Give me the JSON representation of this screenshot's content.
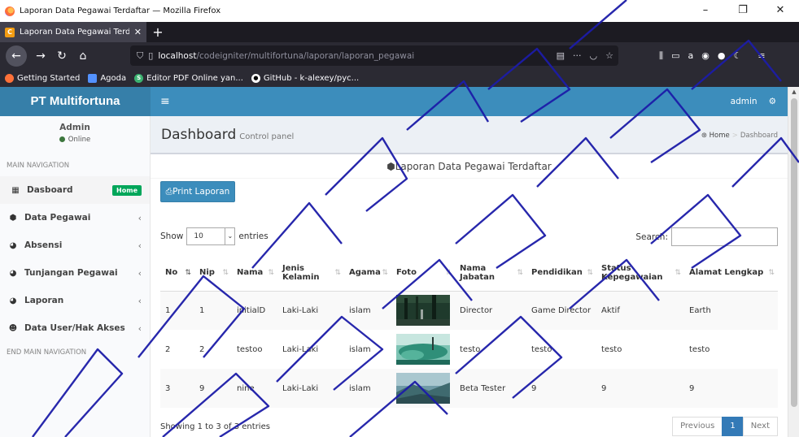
{
  "window": {
    "title": "Laporan Data Pegawai Terdaftar — Mozilla Firefox",
    "controls": {
      "minimize": "–",
      "maximize": "❐",
      "close": "✕"
    }
  },
  "tab": {
    "label": "Laporan Data Pegawai Terdaftar",
    "close": "✕",
    "new_tab": "+"
  },
  "nav": {
    "url_host": "localhost",
    "url_path": "/codeigniter/multifortuna/laporan/laporan_pegawai"
  },
  "bookmarks": [
    {
      "label": "Getting Started",
      "color": "#ff7139"
    },
    {
      "label": "Agoda",
      "color": "#5392ff"
    },
    {
      "label": "Editor PDF Online yan...",
      "color": "#3cb371"
    },
    {
      "label": "GitHub - k-alexey/pyc...",
      "color": "#ffffff"
    }
  ],
  "app": {
    "brand": "PT Multifortuna",
    "user_menu": "admin",
    "user_panel": {
      "name": "Admin",
      "status": "Online"
    },
    "nav_header": "MAIN NAVIGATION",
    "nav_footer": "END MAIN NAVIGATION",
    "menu": [
      {
        "label": "Dasboard",
        "icon": "grid-icon",
        "badge": "Home"
      },
      {
        "label": "Data Pegawai",
        "icon": "cubes-icon",
        "chev": "‹"
      },
      {
        "label": "Absensi",
        "icon": "pie-chart-icon",
        "chev": "‹"
      },
      {
        "label": "Tunjangan Pegawai",
        "icon": "pie-chart-icon",
        "chev": "‹"
      },
      {
        "label": "Laporan",
        "icon": "pie-chart-icon",
        "chev": "‹"
      },
      {
        "label": "Data User/Hak Akses",
        "icon": "users-icon",
        "chev": "‹"
      }
    ]
  },
  "page": {
    "title": "Dashboard",
    "subtitle": "Control panel",
    "breadcrumb": {
      "home": "Home",
      "current": "Dashboard"
    },
    "box_title": "Laporan Data Pegawai Terdaftar",
    "print_button": "Print Laporan",
    "show_label": "Show",
    "entries_value": "10",
    "entries_label": "entries",
    "search_label": "Search:",
    "info": "Showing 1 to 3 of 3 entries",
    "pagination": {
      "prev": "Previous",
      "current": "1",
      "next": "Next"
    }
  },
  "table": {
    "headers": [
      "No",
      "Nip",
      "Nama",
      "Jenis Kelamin",
      "Agama",
      "Foto",
      "Nama Jabatan",
      "Pendidikan",
      "Status Kepegawaian",
      "Alamat Lengkap"
    ],
    "rows": [
      {
        "no": "1",
        "nip": "1",
        "nama": "initialD",
        "jk": "Laki-Laki",
        "agama": "islam",
        "foto": "photo-forest",
        "jabatan": "Director",
        "pendidikan": "Game Director",
        "status": "Aktif",
        "alamat": "Earth"
      },
      {
        "no": "2",
        "nip": "2",
        "nama": "testoo",
        "jk": "Laki-Laki",
        "agama": "islam",
        "foto": "photo-water",
        "jabatan": "testo",
        "pendidikan": "testo",
        "status": "testo",
        "alamat": "testo"
      },
      {
        "no": "3",
        "nip": "9",
        "nama": "nine",
        "jk": "Laki-Laki",
        "agama": "islam",
        "foto": "photo-landscape",
        "jabatan": "Beta Tester",
        "pendidikan": "9",
        "status": "9",
        "alamat": "9"
      }
    ]
  },
  "colors": {
    "header_blue": "#3c8dbc",
    "logo_blue": "#367fa9",
    "badge_green": "#00a65a",
    "watermark": "#1c1ca8"
  }
}
